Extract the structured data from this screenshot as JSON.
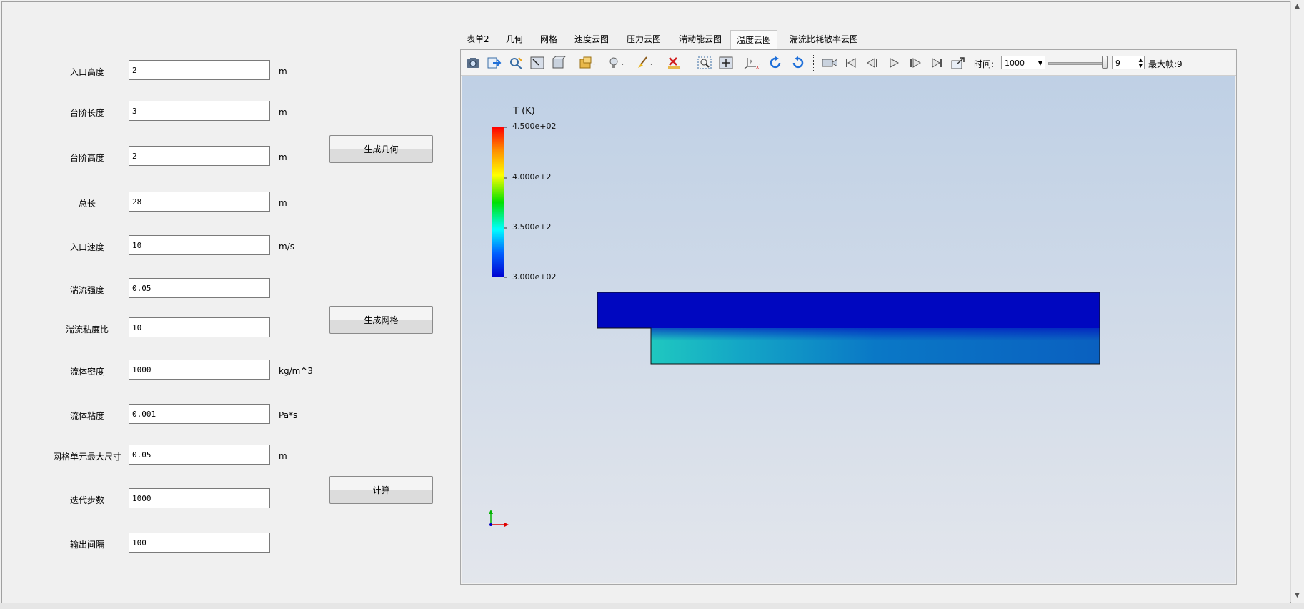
{
  "form": {
    "rows": [
      {
        "label": "入口高度",
        "value": "2",
        "unit": "m"
      },
      {
        "label": "台阶长度",
        "value": "3",
        "unit": "m"
      },
      {
        "label": "台阶高度",
        "value": "2",
        "unit": "m"
      },
      {
        "label": "总长",
        "value": "28",
        "unit": "m"
      },
      {
        "label": "入口速度",
        "value": "10",
        "unit": "m/s"
      },
      {
        "label": "湍流强度",
        "value": "0.05",
        "unit": ""
      },
      {
        "label": "湍流粘度比",
        "value": "10",
        "unit": ""
      },
      {
        "label": "流体密度",
        "value": "1000",
        "unit": "kg/m^3"
      },
      {
        "label": "流体粘度",
        "value": "0.001",
        "unit": "Pa*s"
      },
      {
        "label": "网格单元最大尺寸",
        "value": "0.05",
        "unit": "m"
      },
      {
        "label": "迭代步数",
        "value": "1000",
        "unit": ""
      },
      {
        "label": "输出间隔",
        "value": "100",
        "unit": ""
      }
    ]
  },
  "buttons": {
    "geometry": "生成几何",
    "mesh": "生成网格",
    "compute": "计算"
  },
  "tabs": [
    "表单2",
    "几何",
    "网格",
    "速度云图",
    "压力云图",
    "湍动能云图",
    "温度云图",
    "湍流比耗散率云图"
  ],
  "active_tab": "温度云图",
  "toolbar": {
    "time_label": "时间:",
    "time_value": "1000",
    "frame_value": "9",
    "max_frame_label": "最大帧:9",
    "icons": [
      "camera-icon",
      "export-icon",
      "pick-icon",
      "select-region-icon",
      "box-icon",
      "open-file-icon",
      "light-icon",
      "brush-icon",
      "clear-icon",
      "zoom-box-icon",
      "fit-view-icon",
      "axes-icon",
      "rotate-cw-icon",
      "rotate-ccw-icon",
      "record-icon",
      "first-frame-icon",
      "prev-frame-icon",
      "play-icon",
      "next-frame-icon",
      "last-frame-icon",
      "export-animation-icon"
    ]
  },
  "colorbar": {
    "title": "T (K)",
    "ticks": [
      "4.500e+02",
      "4.000e+2",
      "3.500e+2",
      "3.000e+02"
    ],
    "min": 300,
    "max": 450
  },
  "slider_fraction": 1.0,
  "colors": {
    "viewport_top": "#bfd0e5",
    "viewport_bottom": "#e3e6ec",
    "domain_top": "#0007c0",
    "domain_bottom_left": "#1fc8c0",
    "domain_bottom_right": "#0060c0"
  }
}
